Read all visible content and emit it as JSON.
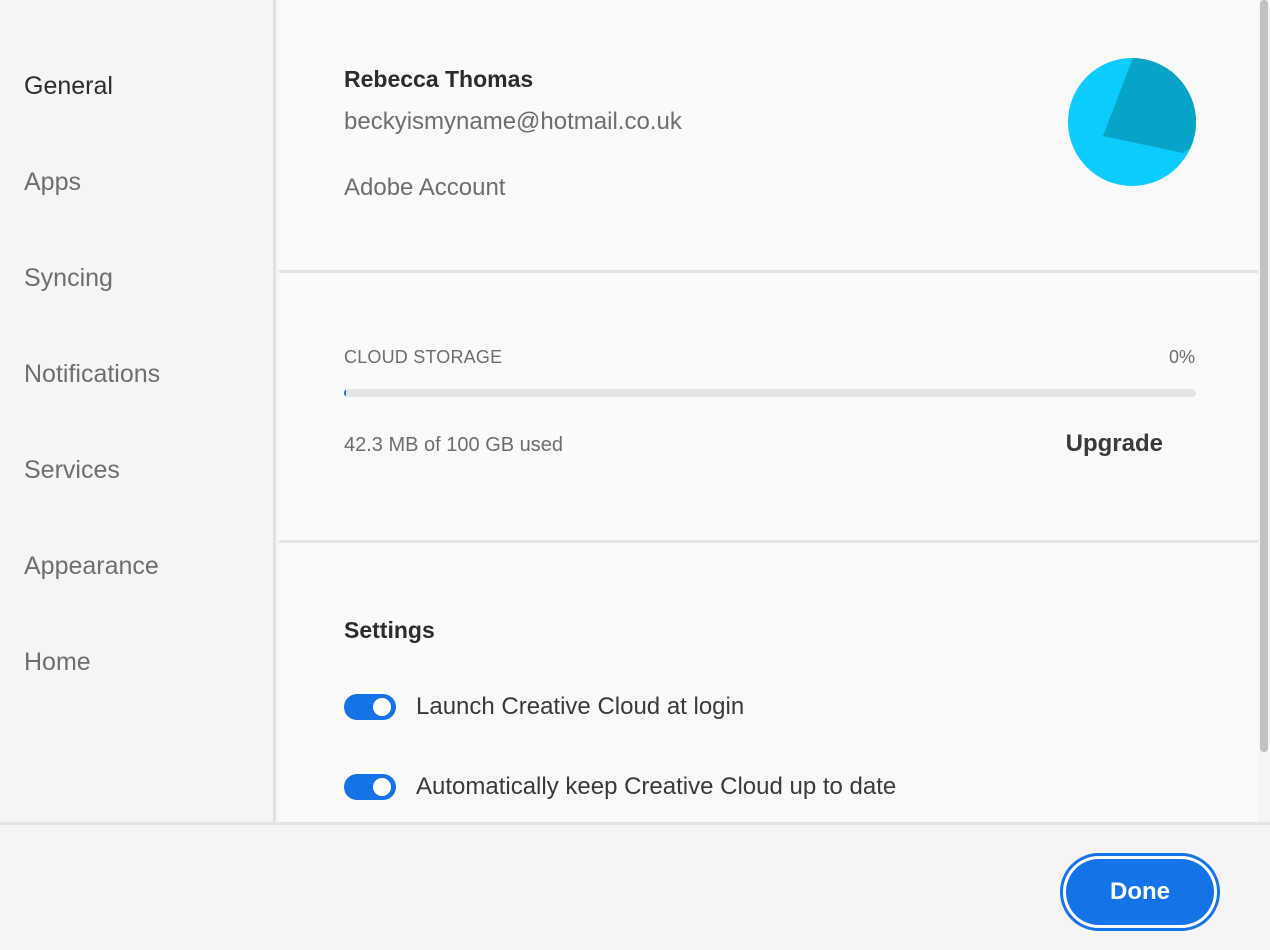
{
  "sidebar": {
    "items": [
      {
        "label": "General",
        "active": true
      },
      {
        "label": "Apps"
      },
      {
        "label": "Syncing"
      },
      {
        "label": "Notifications"
      },
      {
        "label": "Services"
      },
      {
        "label": "Appearance"
      },
      {
        "label": "Home"
      }
    ]
  },
  "account": {
    "name": "Rebecca Thomas",
    "email": "beckyismyname@hotmail.co.uk",
    "link_label": "Adobe Account",
    "avatar_colors": {
      "light": "#0ccbff",
      "dark": "#08a4c8"
    }
  },
  "storage": {
    "label": "CLOUD STORAGE",
    "percent_text": "0%",
    "usage_fraction": 0.0004,
    "used_text": "42.3 MB of 100 GB used",
    "upgrade_label": "Upgrade"
  },
  "settings": {
    "heading": "Settings",
    "options": [
      {
        "label": "Launch Creative Cloud at login",
        "enabled": true
      },
      {
        "label": "Automatically keep Creative Cloud up to date",
        "enabled": true
      }
    ]
  },
  "footer": {
    "done_label": "Done"
  },
  "colors": {
    "accent": "#1473e6"
  }
}
